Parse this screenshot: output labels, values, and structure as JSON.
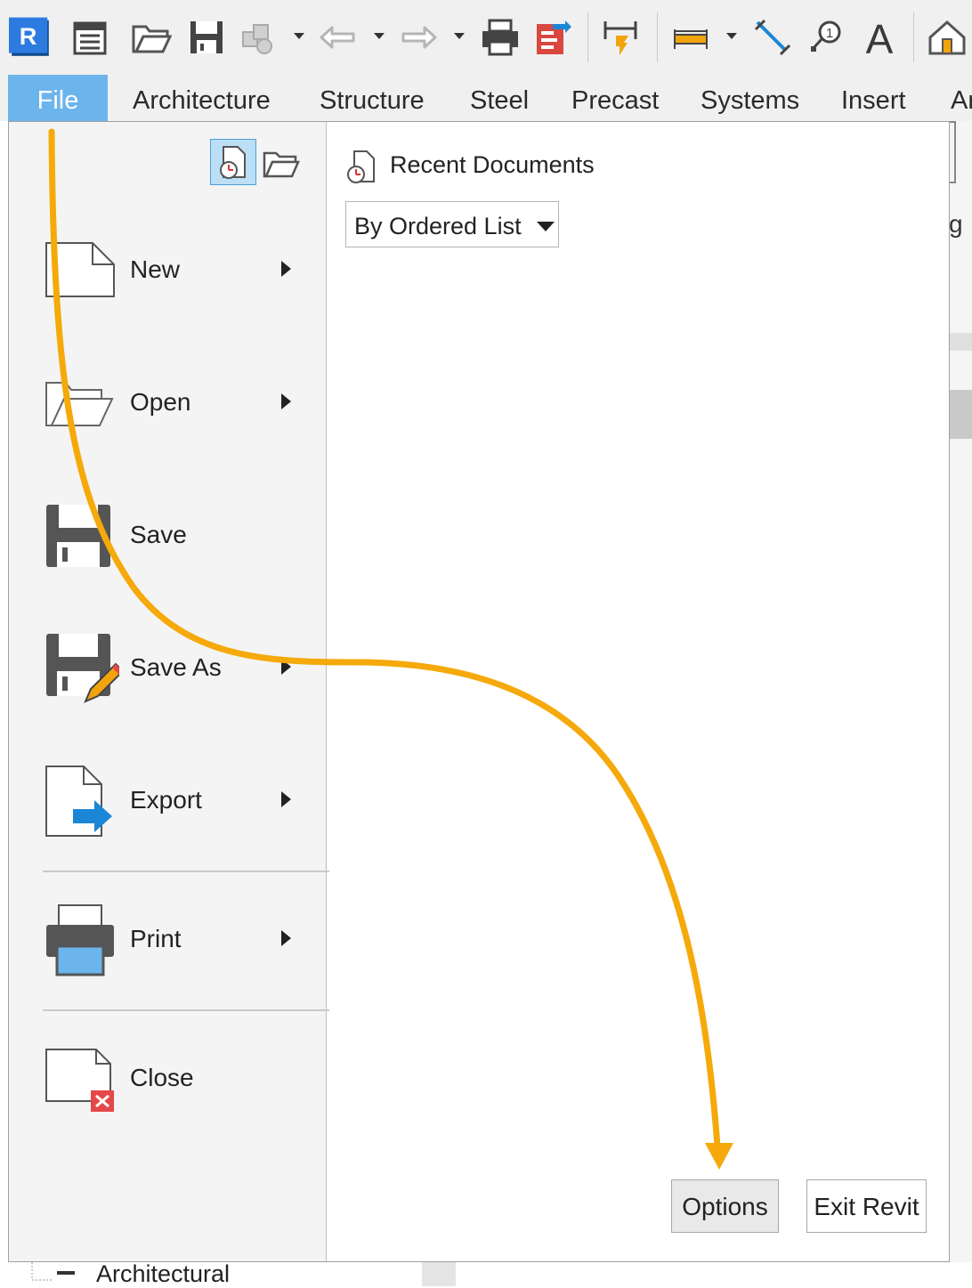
{
  "ribbon": {
    "tabs": [
      {
        "label": "File"
      },
      {
        "label": "Architecture"
      },
      {
        "label": "Structure"
      },
      {
        "label": "Steel"
      },
      {
        "label": "Precast"
      },
      {
        "label": "Systems"
      },
      {
        "label": "Insert"
      },
      {
        "label": "Ar"
      }
    ]
  },
  "quick_access": {
    "app_logo": "R",
    "icons": [
      "revit-logo-icon",
      "properties-icon",
      "open-folder-icon",
      "save-icon",
      "sync-icon",
      "undo-icon",
      "redo-icon",
      "print-icon",
      "export-icon",
      "aligned-dimension-icon",
      "measure-icon",
      "spot-dimension-icon",
      "tag-icon",
      "text-icon",
      "default-3d-view-icon"
    ],
    "text_icon_glyph": "A"
  },
  "application_menu": {
    "items": [
      {
        "label": "New",
        "has_submenu": true
      },
      {
        "label": "Open",
        "has_submenu": true
      },
      {
        "label": "Save",
        "has_submenu": false
      },
      {
        "label": "Save As",
        "has_submenu": true
      },
      {
        "label": "Export",
        "has_submenu": true
      },
      {
        "label": "Print",
        "has_submenu": true
      },
      {
        "label": "Close",
        "has_submenu": false
      }
    ],
    "recent": {
      "title": "Recent Documents",
      "sort_value": "By Ordered List"
    },
    "footer": {
      "options_label": "Options",
      "exit_label": "Exit Revit"
    }
  },
  "project_browser": {
    "node_label": "Architectural"
  },
  "right_edge_text": "g",
  "colors": {
    "file_tab": "#6cb4ec",
    "annotation_arrow": "#f5a90a",
    "revit_logo": "#1f6fd1"
  }
}
